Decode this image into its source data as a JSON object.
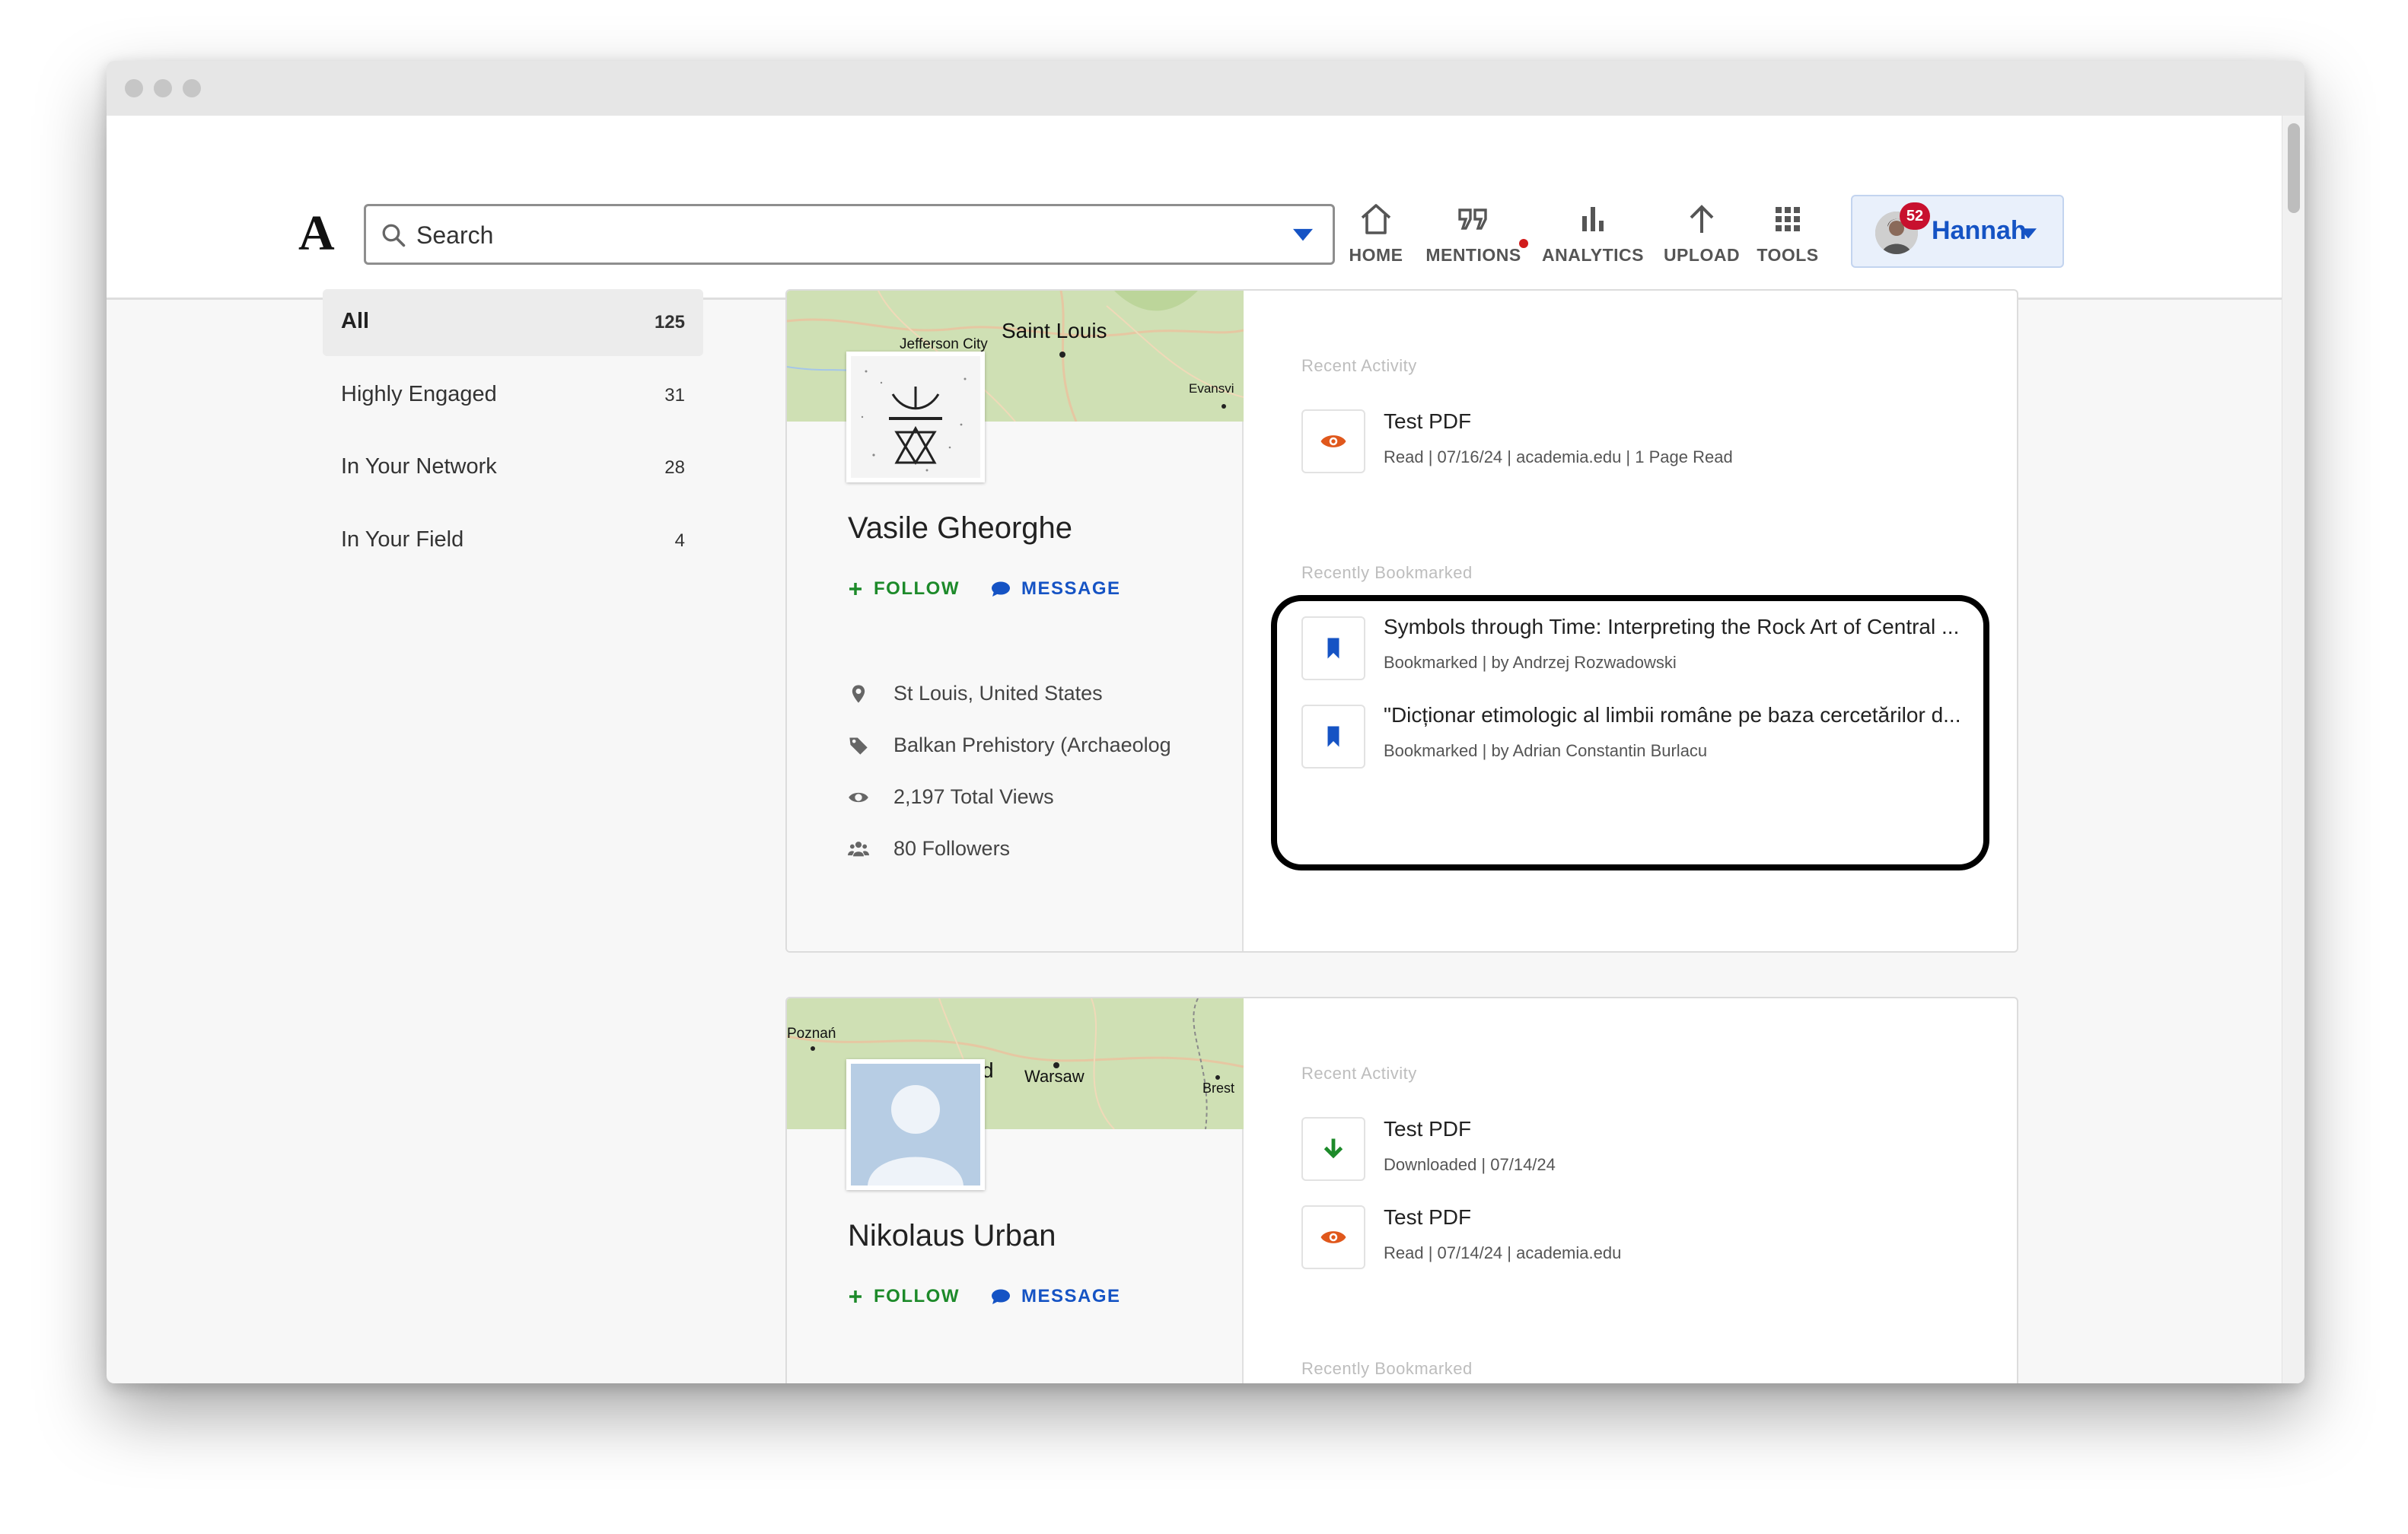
{
  "header": {
    "logo": "A",
    "search_placeholder": "Search",
    "nav": [
      {
        "label": "HOME",
        "icon": "home-icon"
      },
      {
        "label": "MENTIONS",
        "icon": "quote-icon"
      },
      {
        "label": "ANALYTICS",
        "icon": "bar-chart-icon"
      },
      {
        "label": "UPLOAD",
        "icon": "arrow-up-icon"
      },
      {
        "label": "TOOLS",
        "icon": "grid-icon"
      }
    ],
    "user": {
      "name": "Hannah",
      "notifications": "52"
    }
  },
  "filters": [
    {
      "label": "All",
      "count": "125"
    },
    {
      "label": "Highly Engaged",
      "count": "31"
    },
    {
      "label": "In Your Network",
      "count": "28"
    },
    {
      "label": "In Your Field",
      "count": "4"
    }
  ],
  "cards": [
    {
      "map_labels": [
        "Saint Louis",
        "Jefferson City",
        "Evansvi"
      ],
      "name": "Vasile Gheorghe",
      "follow_label": "FOLLOW",
      "message_label": "MESSAGE",
      "location": "St Louis, United States",
      "field": "Balkan Prehistory (Archaeolog",
      "views": "2,197 Total Views",
      "followers": "80 Followers",
      "recent_activity_title": "Recent Activity",
      "activities": [
        {
          "title": "Test PDF",
          "sub": "Read  |  07/16/24  |  academia.edu  |  1 Page Read",
          "icon": "eye-icon"
        }
      ],
      "recently_bookmarked_title": "Recently Bookmarked",
      "bookmarks": [
        {
          "title": "Symbols through Time: Interpreting the Rock Art of Central ...",
          "sub": "Bookmarked  |  by Andrzej Rozwadowski",
          "icon": "bookmark-icon"
        },
        {
          "title": "\"Dicționar etimologic al limbii române pe baza cercetărilor d...",
          "sub": "Bookmarked  |  by Adrian Constantin Burlacu",
          "icon": "bookmark-icon"
        }
      ]
    },
    {
      "map_labels": [
        "Poznań",
        "d",
        "Warsaw",
        "Brest"
      ],
      "name": "Nikolaus Urban",
      "follow_label": "FOLLOW",
      "message_label": "MESSAGE",
      "recent_activity_title": "Recent Activity",
      "activities": [
        {
          "title": "Test PDF",
          "sub": "Downloaded  |  07/14/24",
          "icon": "download-icon"
        },
        {
          "title": "Test PDF",
          "sub": "Read  |  07/14/24  |  academia.edu",
          "icon": "eye-icon"
        }
      ],
      "recently_bookmarked_title": "Recently Bookmarked"
    }
  ],
  "colors": {
    "follow": "#1d8a2a",
    "message": "#1553c4",
    "badge": "#c8102e",
    "eye": "#e0581c",
    "download": "#1d8a2a"
  }
}
